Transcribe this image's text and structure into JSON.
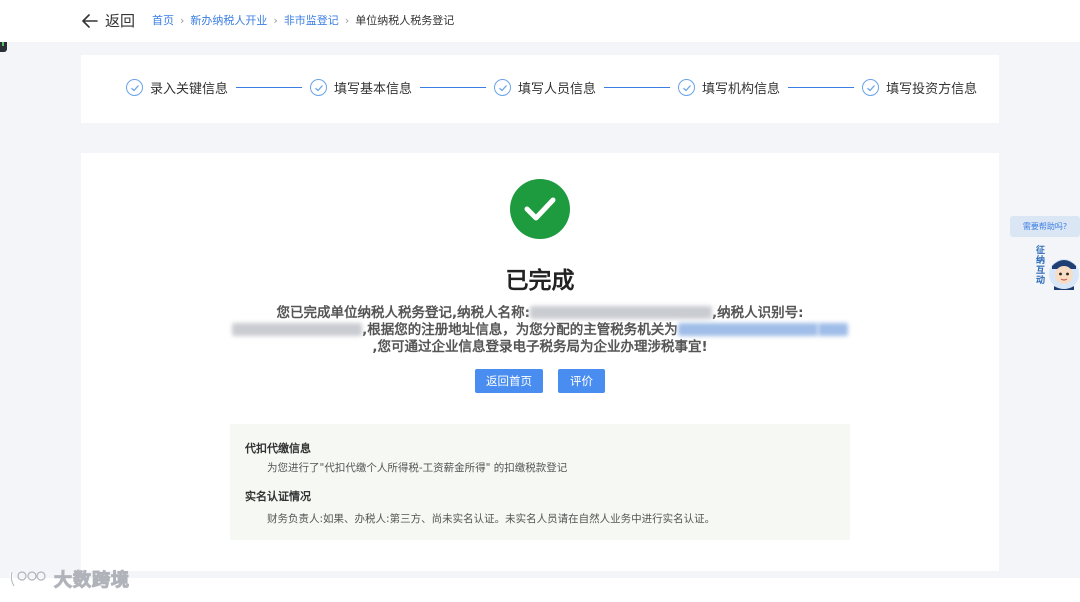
{
  "header": {
    "back_label": "返回",
    "breadcrumb": {
      "home": "首页",
      "section": "新办纳税人开业",
      "subsection": "非市监登记",
      "current": "单位纳税人税务登记",
      "separator": "›"
    }
  },
  "steps": [
    {
      "label": "录入关键信息",
      "status": "done"
    },
    {
      "label": "填写基本信息",
      "status": "done"
    },
    {
      "label": "填写人员信息",
      "status": "done"
    },
    {
      "label": "填写机构信息",
      "status": "done"
    },
    {
      "label": "填写投资方信息",
      "status": "done"
    }
  ],
  "result": {
    "title": "已完成",
    "message_part1": "您已完成单位纳税人税务登记,纳税人名称:",
    "message_part2": ",纳税人识别号:",
    "message_part3": ",根据您的注册地址信息，为您分配的主管税务机关为",
    "message_part4": ",您可通过企业信息登录电子税务局为企业办理涉税事宜!"
  },
  "buttons": {
    "home": "返回首页",
    "rate": "评价"
  },
  "info": {
    "withholding_title": "代扣代缴信息",
    "withholding_text": "为您进行了\"代扣代缴个人所得税-工资薪金所得\" 的扣缴税款登记",
    "realname_title": "实名认证情况",
    "realname_text": "财务负责人:如果、办税人:第三方、尚未实名认证。未实名人员请在自然人业务中进行实名认证。"
  },
  "assistant": {
    "bubble": "需要帮助吗?",
    "label": "征纳互动"
  },
  "watermark": "大数跨境",
  "colors": {
    "accent": "#3a7ee3",
    "button": "#4a8df0",
    "success": "#1e9b3f",
    "page_bg": "#f3f5f8"
  }
}
